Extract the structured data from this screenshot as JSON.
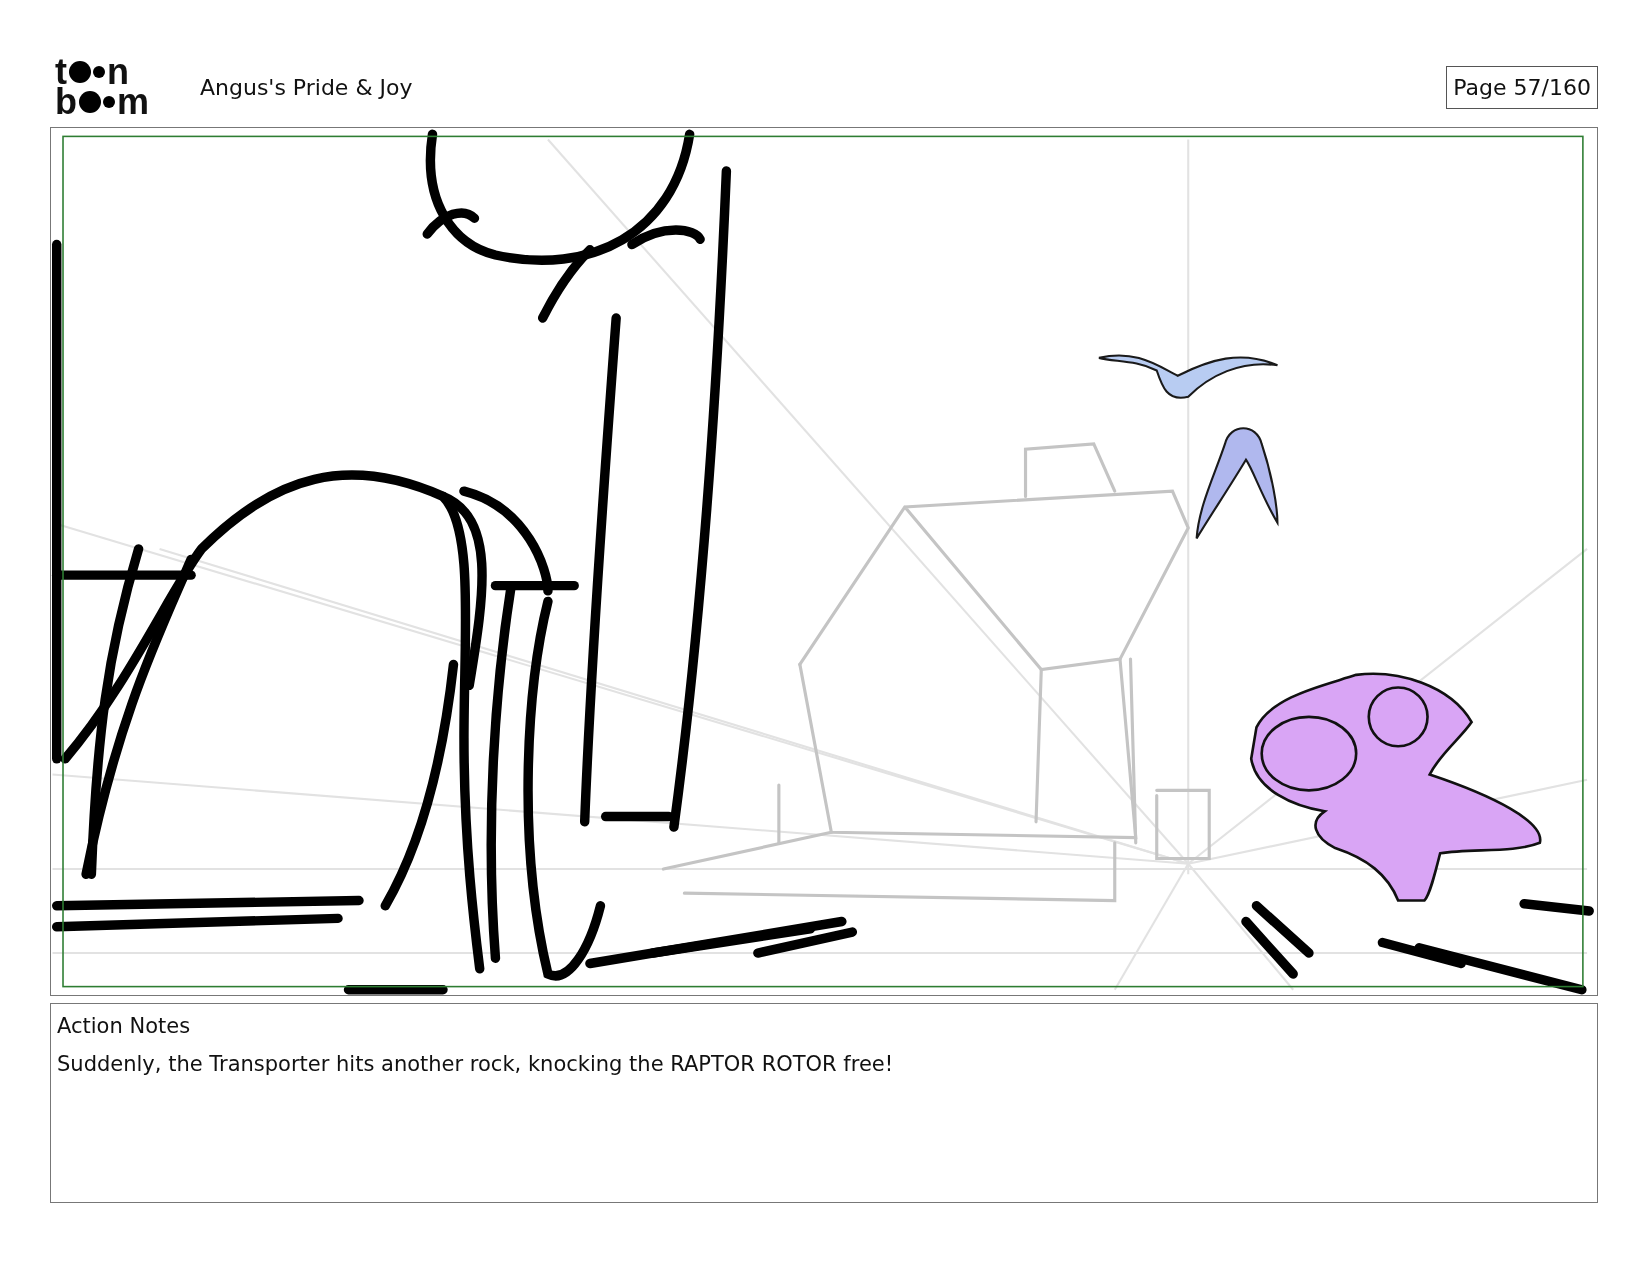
{
  "logo": {
    "rows": [
      {
        "first": "t",
        "last": "n"
      },
      {
        "first": "b",
        "last": "m"
      }
    ]
  },
  "project_title": "Angus's Pride & Joy",
  "page_label": "Page  57/160",
  "panel": {
    "kind": "sketch"
  },
  "notes": {
    "heading": "Action Notes",
    "text": "Suddenly, the Transporter hits another rock, knocking the RAPTOR ROTOR free!"
  }
}
